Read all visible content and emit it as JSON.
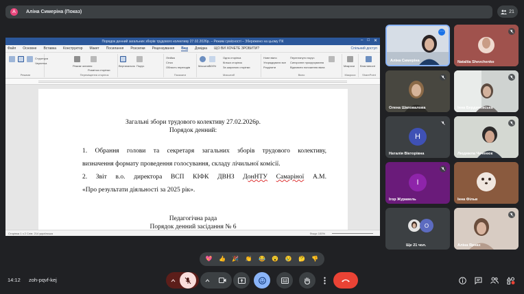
{
  "presenter": {
    "avatar_letter": "А",
    "name": "Аліна Симеріна (Показ)"
  },
  "participant_count": "21",
  "word": {
    "window_title": "Порядок денний загальних зборів трудового колективу 27.02.2026р. – Режим сумісності – Збережено на цьому ПК",
    "tabs": [
      "Файл",
      "Основне",
      "Вставка",
      "Конструктор",
      "Макет",
      "Посилання",
      "Розсилки",
      "Рецензування",
      "Вигляд",
      "Довідка"
    ],
    "active_tab": "Вид",
    "search_hint": "ЩО ВИ ХОЧЕТЕ ЗРОБИТИ?",
    "share": "Спільний доступ",
    "ribbon": {
      "view_modes": [
        "Режим читання",
        "Розмітка сторінки",
        "Веб-документ"
      ],
      "move": [
        "Структура",
        "Чернетка"
      ],
      "page_move": [
        "Вертикально",
        "Поруч"
      ],
      "show": [
        "Лінійка",
        "Сітка",
        "Область переходів"
      ],
      "zoom": [
        "Масштаб",
        "100%"
      ],
      "pages": [
        "Одна сторінка",
        "Кілька сторінок",
        "За шириною сторінки"
      ],
      "window": [
        "Нове вікно",
        "Упорядкувати все",
        "Розділити"
      ],
      "window2": [
        "Переглянути поруч",
        "Синхронне прокручування",
        "Відновити положення вікна"
      ],
      "switch": [
        "Перейти до іншого вікна"
      ],
      "macros": [
        "Макроси"
      ],
      "sharepoint": [
        "Властивості"
      ],
      "group_labels": [
        "Режими",
        "Переміщення сторінок",
        "Показати",
        "Масштаб",
        "Вікно",
        "Макроси",
        "SharePoint"
      ]
    },
    "status": {
      "left": "Сторінка 1 з 2    Слів: 214    українська",
      "right": "Фокус    100%"
    }
  },
  "document": {
    "title_line1": "Загальні збори трудового колективу 27.02.2026р.",
    "title_line2": "Порядок денний:",
    "item1_line1": "1. Обрання голови та секретаря загальних зборів трудового колективу,",
    "item1_line2": "визначення формату проведення голосування, складу лічильної комісії.",
    "item2_pre": "2. Звіт в.о. директора ВСП КІФК ДВНЗ ",
    "item2_underlined1": "ДонНТУ",
    "item2_space": " ",
    "item2_underlined2": "Самаріної",
    "item2_post": " А.М.",
    "item2_line2": "«Про результати діяльності за 2025 рік».",
    "section2_title": "Педагогічна рада",
    "section2_subtitle": "Порядок денний засідання № 6"
  },
  "participants": [
    {
      "name": "Аліна Симеріна",
      "kind": "video",
      "speaking": true
    },
    {
      "name": "Nataliia Shevchenko",
      "kind": "video"
    },
    {
      "name": "Олена Шаповалова",
      "kind": "video"
    },
    {
      "name": "Інна Бердичевська",
      "kind": "video"
    },
    {
      "name": "Наталія Вікторівна",
      "kind": "avatar",
      "letter": "Н",
      "color": "#3f51b5"
    },
    {
      "name": "Людмила Чеченюк",
      "kind": "video"
    },
    {
      "name": "Ігор Журавель",
      "kind": "avatar",
      "letter": "І",
      "color": "#8e24aa"
    },
    {
      "name": "Інна Фільв",
      "kind": "video"
    },
    {
      "name": "Ще 21 чол.",
      "kind": "group",
      "letter": "О"
    },
    {
      "name": "Аліна Ярнах",
      "kind": "video"
    }
  ],
  "reactions": [
    "💖",
    "👍",
    "🎉",
    "👏",
    "😂",
    "😮",
    "😢",
    "🤔",
    "👎"
  ],
  "bottom": {
    "time": "14:12",
    "meeting_code": "zoh-pqvf-kej"
  },
  "colors": {
    "word_blue": "#2b579a",
    "hangup_red": "#ea4335",
    "mic_off_bg": "#f9dedc",
    "active_blue": "#8ab4f8",
    "meet_bg": "#202124",
    "control_gray": "#3c4043"
  }
}
